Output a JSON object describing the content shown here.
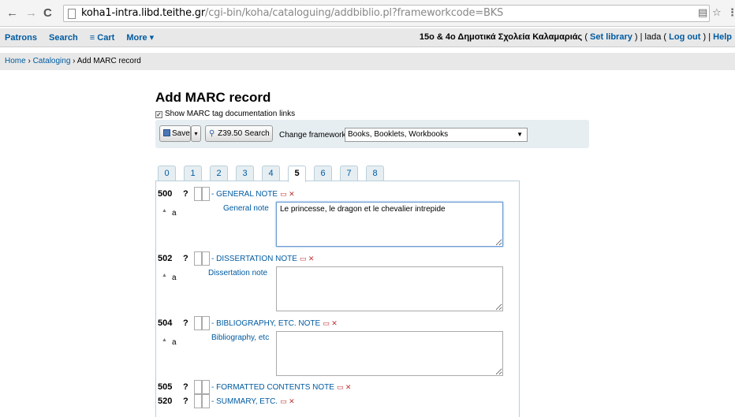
{
  "browser": {
    "back_icon": "←",
    "forward_icon": "→",
    "reload_icon": "C",
    "url_host": "koha1-intra.libd.teithe.gr",
    "url_path": "/cgi-bin/koha/cataloguing/addbiblio.pl?frameworkcode=BKS",
    "translate_icon": "▤",
    "star_icon": "☆",
    "menu_icon": "⋮"
  },
  "header": {
    "nav": [
      "Patrons",
      "Search",
      "≡ Cart",
      "More ▾"
    ],
    "library": "15ο & 4ο Δημοτικά Σχολεία Καλαμαριάς",
    "paren_open": "( ",
    "set_library": "Set library",
    "sep1": " ) | lada ( ",
    "log_out": "Log out",
    "sep2": " ) | ",
    "help": "Help"
  },
  "breadcrumb": {
    "home": "Home",
    "sep": " › ",
    "cataloging": "Cataloging",
    "current": "Add MARC record"
  },
  "main": {
    "title": "Add MARC record",
    "show_doc_label": "Show MARC tag documentation links",
    "show_doc_checked": true
  },
  "toolbar": {
    "save_label": "Save",
    "caret": "▾",
    "z3950_label": "Z39.50 Search",
    "framework_label": "Change framework:",
    "framework_value": "Books, Booklets, Workbooks",
    "select_arrow": "▼"
  },
  "tabs": [
    "0",
    "1",
    "2",
    "3",
    "4",
    "5",
    "6",
    "7",
    "8"
  ],
  "active_tab": "5",
  "fields": [
    {
      "tag": "500",
      "qm": "?",
      "label": "- GENERAL NOTE",
      "icons": "▭ ✕",
      "subfield": {
        "code": "a",
        "label": "General note",
        "value": "Le princesse, le dragon et le chevalier intrepide"
      }
    },
    {
      "tag": "502",
      "qm": "?",
      "label": "- DISSERTATION NOTE",
      "icons": "▭ ✕",
      "subfield": {
        "code": "a",
        "label": "Dissertation note",
        "value": ""
      }
    },
    {
      "tag": "504",
      "qm": "?",
      "label": "- BIBLIOGRAPHY, ETC. NOTE",
      "icons": "▭ ✕",
      "subfield": {
        "code": "a",
        "label": "Bibliography, etc",
        "value": ""
      }
    },
    {
      "tag": "505",
      "qm": "?",
      "label": "- FORMATTED CONTENTS NOTE",
      "icons": "▭ ✕"
    },
    {
      "tag": "520",
      "qm": "?",
      "label": "- SUMMARY, ETC.",
      "icons": "▭ ✕"
    }
  ],
  "subfield_arrow": "▲"
}
